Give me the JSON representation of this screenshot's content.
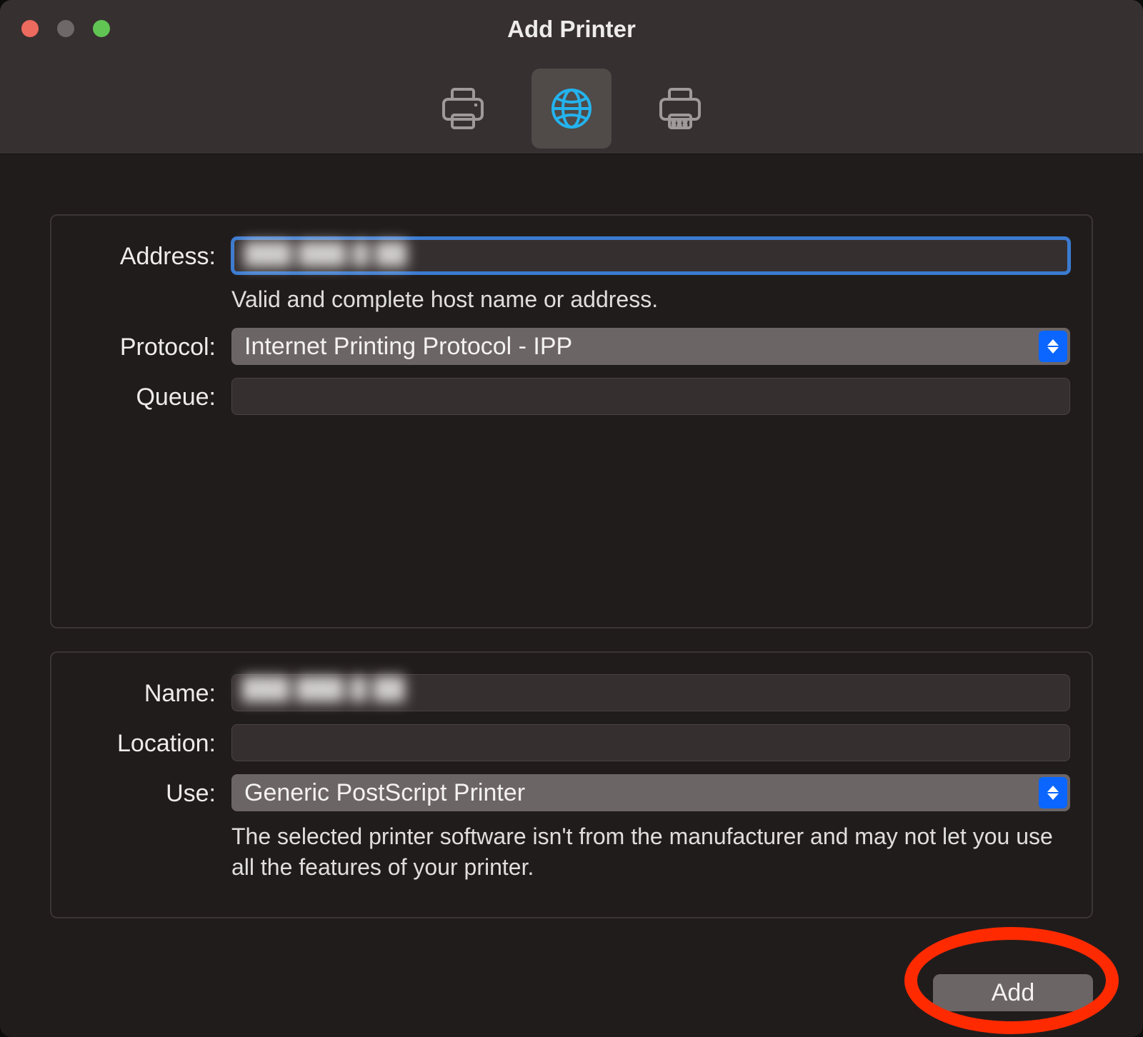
{
  "window": {
    "title": "Add Printer"
  },
  "tabs": {
    "default_icon": "printer-icon",
    "ip_icon": "globe-icon",
    "windows_icon": "windows-printer-icon",
    "selected": "ip"
  },
  "form": {
    "address": {
      "label": "Address:",
      "value": "███ ███.█ ██",
      "hint": "Valid and complete host name or address."
    },
    "protocol": {
      "label": "Protocol:",
      "value": "Internet Printing Protocol - IPP"
    },
    "queue": {
      "label": "Queue:",
      "value": ""
    },
    "name": {
      "label": "Name:",
      "value": "███ ███.█ ██"
    },
    "location": {
      "label": "Location:",
      "value": ""
    },
    "use": {
      "label": "Use:",
      "value": "Generic PostScript Printer",
      "hint": "The selected printer software isn't from the manufacturer and may not let you use all the features of your printer."
    }
  },
  "buttons": {
    "add": "Add"
  }
}
